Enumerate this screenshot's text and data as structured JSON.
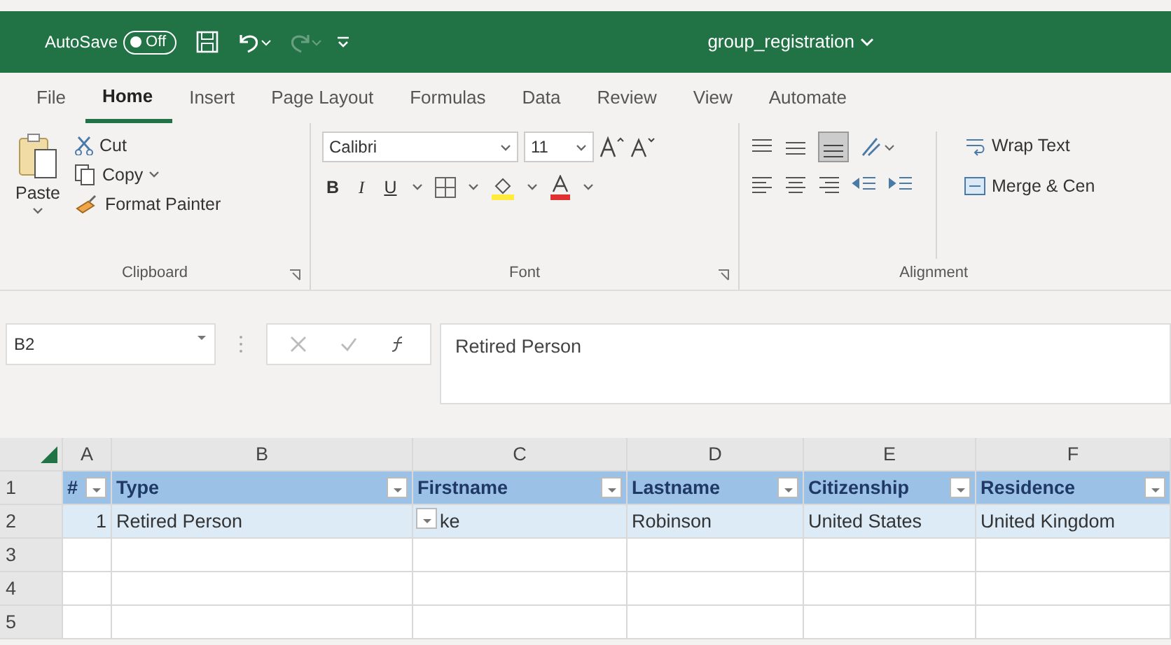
{
  "title_bar": {
    "autosave_label": "AutoSave",
    "autosave_toggle": {
      "label": "Off",
      "on": false
    },
    "document_title": "group_registration"
  },
  "tabs": [
    {
      "label": "File",
      "selected": false
    },
    {
      "label": "Home",
      "selected": true
    },
    {
      "label": "Insert",
      "selected": false
    },
    {
      "label": "Page Layout",
      "selected": false
    },
    {
      "label": "Formulas",
      "selected": false
    },
    {
      "label": "Data",
      "selected": false
    },
    {
      "label": "Review",
      "selected": false
    },
    {
      "label": "View",
      "selected": false
    },
    {
      "label": "Automate",
      "selected": false
    }
  ],
  "clipboard": {
    "paste": "Paste",
    "cut": "Cut",
    "copy": "Copy",
    "format_painter": "Format Painter",
    "label": "Clipboard"
  },
  "font": {
    "font_name": "Calibri",
    "font_size": "11",
    "bold": "B",
    "italic": "I",
    "underline": "U",
    "label": "Font"
  },
  "alignment": {
    "wrap_text": "Wrap Text",
    "merge": "Merge & Cen",
    "label": "Alignment"
  },
  "formula_bar": {
    "name_box": "B2",
    "formula": "Retired Person"
  },
  "sheet": {
    "columns": [
      "A",
      "B",
      "C",
      "D",
      "E",
      "F"
    ],
    "header_row": {
      "number": "1",
      "cells": [
        "#",
        "Type",
        "Firstname",
        "Lastname",
        "Citizenship",
        "Residence"
      ]
    },
    "rows": [
      {
        "number": "2",
        "selected": true,
        "cells": [
          "1",
          "Retired Person",
          "ke",
          "Robinson",
          "United States",
          "United Kingdom"
        ]
      },
      {
        "number": "3",
        "selected": false,
        "cells": [
          "",
          "",
          "",
          "",
          "",
          ""
        ]
      },
      {
        "number": "4",
        "selected": false,
        "cells": [
          "",
          "",
          "",
          "",
          "",
          ""
        ]
      },
      {
        "number": "5",
        "selected": false,
        "cells": [
          "",
          "",
          "",
          "",
          "",
          ""
        ]
      }
    ]
  }
}
